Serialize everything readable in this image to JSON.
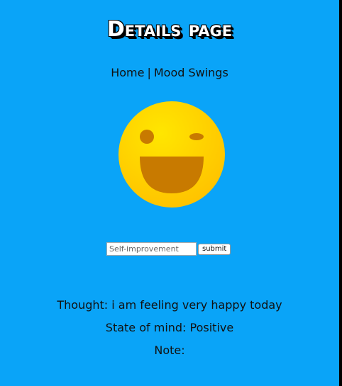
{
  "header": {
    "title": "Details page"
  },
  "nav": {
    "home_label": "Home",
    "separator": "|",
    "mood_swings_label": "Mood Swings"
  },
  "emoji": {
    "icon": "winking-laughing-face-icon",
    "face_color": "#ffd400",
    "feature_color": "#c87a00"
  },
  "form": {
    "input_value": "",
    "input_placeholder": "Self-improvement",
    "submit_label": "submit"
  },
  "details": {
    "thought_text": "Thought: i am feeling very happy today",
    "state_text": "State of mind: Positive",
    "note_text": "Note:"
  },
  "colors": {
    "background": "#0aa4f8",
    "title": "#ffffff",
    "text": "#111111"
  }
}
